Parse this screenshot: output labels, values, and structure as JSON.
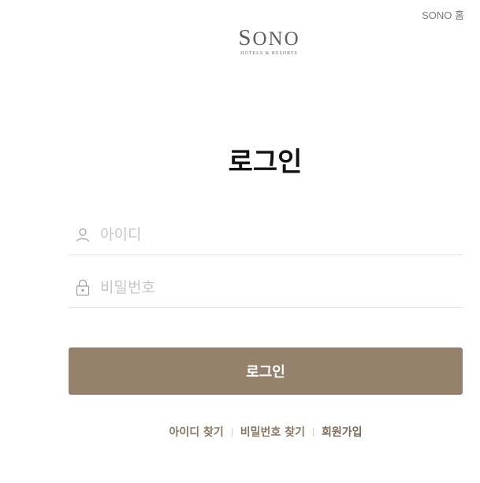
{
  "header": {
    "home_link": "SONO 홈"
  },
  "logo": {
    "main_first": "S",
    "main_rest": "ONO",
    "sub": "HOTELS & RESORTS"
  },
  "title": "로그인",
  "form": {
    "id_placeholder": "아이디",
    "id_value": "",
    "password_placeholder": "비밀번호",
    "password_value": "",
    "login_button": "로그인"
  },
  "links": {
    "find_id": "아이디 찾기",
    "find_password": "비밀번호 찾기",
    "signup": "회원가입"
  },
  "colors": {
    "accent": "#94806b",
    "link": "#8a7763",
    "placeholder": "#c6c6c6"
  },
  "icons": {
    "id_field": "user-icon",
    "password_field": "lock-icon"
  }
}
